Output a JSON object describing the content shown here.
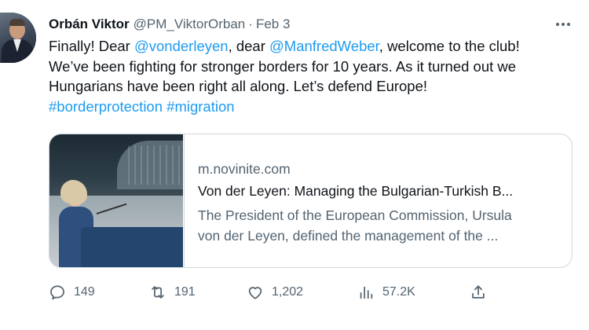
{
  "author": {
    "name": "Orbán Viktor",
    "handle": "@PM_ViktorOrban",
    "separator": "·",
    "date": "Feb 3"
  },
  "tweet": {
    "line1": {
      "t1": "Finally! Dear ",
      "mention1": "@vonderleyen",
      "t2": ", dear ",
      "mention2": "@ManfredWeber",
      "t3": ", welcome to the club!"
    },
    "line2": "We’ve been fighting for stronger borders for 10 years. As it turned out we",
    "line3": "Hungarians have been right all along. Let’s defend Europe!",
    "hashtag1": "#borderprotection",
    "hashtag2": "#migration"
  },
  "card": {
    "domain": "m.novinite.com",
    "title": "Von der Leyen: Managing the Bulgarian-Turkish B...",
    "description_line1": "The President of the European Commission, Ursula",
    "description_line2": "von der Leyen, defined the management of the ..."
  },
  "actions": {
    "replies": "149",
    "retweets": "191",
    "likes": "1,202",
    "views": "57.2K"
  },
  "colors": {
    "link": "#1d9bf0",
    "text": "#0f1419",
    "secondary": "#536471",
    "border": "#cfd9de"
  },
  "icons": {
    "more": "more-horizontal-icon",
    "reply": "reply-icon",
    "retweet": "retweet-icon",
    "like": "heart-icon",
    "views": "views-icon",
    "share": "share-icon"
  }
}
